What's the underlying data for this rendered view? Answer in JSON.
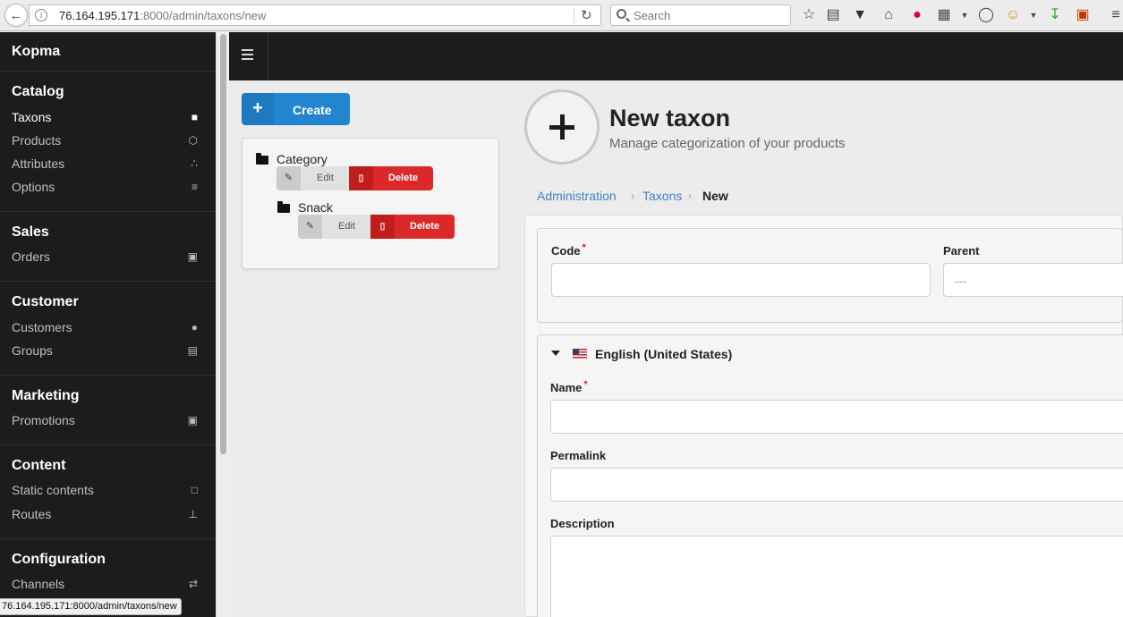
{
  "browser": {
    "url_host": "76.164.195.171",
    "url_rest": ":8000/admin/taxons/new",
    "search_placeholder": "Search",
    "status_text": "76.164.195.171:8000/admin/taxons/new"
  },
  "sidebar": {
    "brand": "Kopma",
    "sections": [
      {
        "title": "Catalog",
        "items": [
          {
            "label": "Taxons",
            "icon": "folder-icon",
            "active": true
          },
          {
            "label": "Products",
            "icon": "cube-icon"
          },
          {
            "label": "Attributes",
            "icon": "cubes-icon"
          },
          {
            "label": "Options",
            "icon": "sliders-icon"
          }
        ]
      },
      {
        "title": "Sales",
        "items": [
          {
            "label": "Orders",
            "icon": "cart-icon"
          }
        ]
      },
      {
        "title": "Customer",
        "items": [
          {
            "label": "Customers",
            "icon": "users-icon"
          },
          {
            "label": "Groups",
            "icon": "archive-icon"
          }
        ]
      },
      {
        "title": "Marketing",
        "items": [
          {
            "label": "Promotions",
            "icon": "cart-plus-icon"
          }
        ]
      },
      {
        "title": "Content",
        "items": [
          {
            "label": "Static contents",
            "icon": "file-icon"
          },
          {
            "label": "Routes",
            "icon": "sitemap-icon"
          }
        ]
      },
      {
        "title": "Configuration",
        "items": [
          {
            "label": "Channels",
            "icon": "shuffle-icon"
          }
        ]
      }
    ]
  },
  "main": {
    "create_label": "Create",
    "tree": [
      {
        "label": "Category",
        "edit_label": "Edit",
        "delete_label": "Delete"
      },
      {
        "label": "Snack",
        "edit_label": "Edit",
        "delete_label": "Delete"
      }
    ],
    "header": {
      "title": "New taxon",
      "subtitle": "Manage categorization of your products"
    },
    "breadcrumb": [
      "Administration",
      "Taxons",
      "New"
    ],
    "form": {
      "code_label": "Code",
      "parent_label": "Parent",
      "parent_value": "---",
      "language": "English (United States)",
      "name_label": "Name",
      "permalink_label": "Permalink",
      "description_label": "Description",
      "required_mark": "*"
    }
  }
}
